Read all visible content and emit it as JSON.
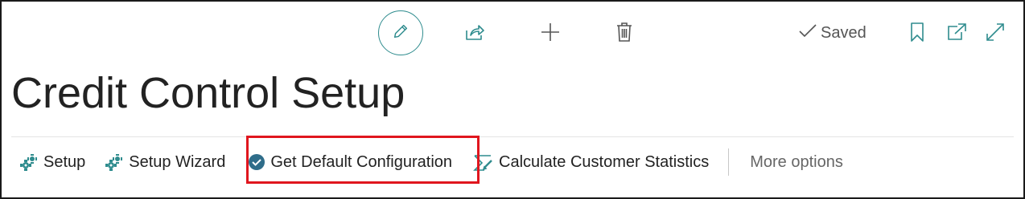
{
  "page": {
    "title": "Credit Control Setup",
    "saved_label": "Saved"
  },
  "top_toolbar": {
    "icons": [
      "pencil-icon",
      "share-icon",
      "plus-icon",
      "trash-icon",
      "bookmark-icon",
      "open-new-window-icon",
      "expand-icon"
    ]
  },
  "actions": [
    {
      "label": "Setup",
      "icon": "setup-icon"
    },
    {
      "label": "Setup Wizard",
      "icon": "setup-wizard-icon"
    },
    {
      "label": "Get Default Configuration",
      "icon": "check-circle-icon",
      "highlighted": true
    },
    {
      "label": "Calculate Customer Statistics",
      "icon": "calculate-icon"
    },
    {
      "label": "More options"
    }
  ],
  "colors": {
    "accent": "#2f8c8e",
    "highlight_border": "#e0161e",
    "text": "#222222"
  }
}
